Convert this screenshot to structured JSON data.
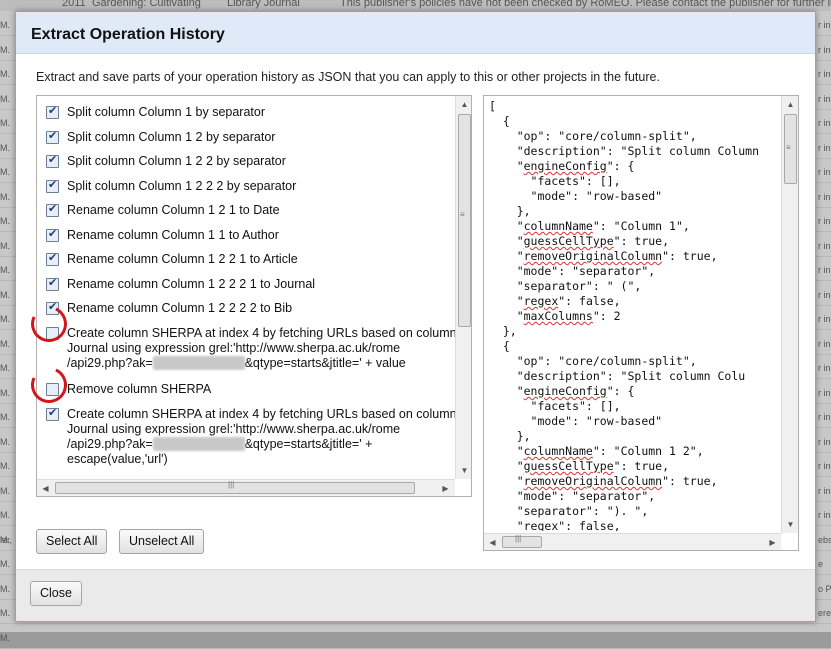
{
  "background": {
    "top_row": {
      "year": "2011",
      "title": "Gardening: Cultivating",
      "journal": "Library Journal",
      "notice": "This publisher's policies have not been checked by RoMEO. Please contact the publisher for further in"
    },
    "left_fragments": [
      "M.",
      "M.",
      "M.",
      "M.",
      "M.",
      "M.",
      "M.",
      "M.",
      "M.",
      "M.",
      "M.",
      "M.",
      "M.",
      "M.",
      "M.",
      "M.",
      "M.",
      "M.",
      "M.",
      "M.",
      "M.",
      "M.",
      "M.",
      "M.",
      "M.",
      "M.",
      "M.",
      "M.",
      "M.",
      "M.",
      "M."
    ],
    "right_fragments": [
      "r in",
      "r in",
      "r in",
      "r in",
      "r in",
      "r in",
      "r in",
      "r in",
      "r in",
      "r in",
      "r in",
      "r in",
      "r in",
      "r in",
      "r in",
      "r in",
      "r in",
      "r in",
      "r in",
      "r in",
      "r in",
      "ebs",
      "e",
      "o P",
      "ere"
    ],
    "left_extra": "ler,"
  },
  "dialog": {
    "title": "Extract Operation History",
    "intro": "Extract and save parts of your operation history as JSON that you can apply to this or other projects in the future."
  },
  "operations": [
    {
      "checked": true,
      "label": "Split column Column 1 by separator"
    },
    {
      "checked": true,
      "label": "Split column Column 1 2 by separator"
    },
    {
      "checked": true,
      "label": "Split column Column 1 2 2 by separator"
    },
    {
      "checked": true,
      "label": "Split column Column 1 2 2 2 by separator"
    },
    {
      "checked": true,
      "label": "Rename column Column 1 2 1 to Date"
    },
    {
      "checked": true,
      "label": "Rename column Column 1 1 to Author"
    },
    {
      "checked": true,
      "label": "Rename column Column 1 2 2 1 to Article"
    },
    {
      "checked": true,
      "label": "Rename column Column 1 2 2 2 1 to Journal"
    },
    {
      "checked": true,
      "label": "Rename column Column 1 2 2 2 2 to Bib"
    },
    {
      "checked": false,
      "label_a": "Create column SHERPA at index 4 by fetching URLs based on column Journal using expression grel:'http://www.sherpa.ac.uk/rome /api29.php?ak=",
      "label_b": "&qtype=starts&jtitle=' + value",
      "redacted": "XXXXXXXXXXX"
    },
    {
      "checked": false,
      "label": "Remove column SHERPA"
    },
    {
      "checked": true,
      "label_a": "Create column SHERPA at index 4 by fetching URLs based on column Journal using expression grel:'http://www.sherpa.ac.uk/rome /api29.php?ak=",
      "label_b": "&qtype=starts&jtitle=' + escape(value,'url')",
      "redacted": "XXXXXXXXXXX"
    }
  ],
  "json_lines": [
    "[",
    "  {",
    "    \"op\": \"core/column-split\",",
    "    \"description\": \"Split column Column",
    "    \"engineConfig\": {",
    "      \"facets\": [],",
    "      \"mode\": \"row-based\"",
    "    },",
    "    \"columnName\": \"Column 1\",",
    "    \"guessCellType\": true,",
    "    \"removeOriginalColumn\": true,",
    "    \"mode\": \"separator\",",
    "    \"separator\": \" (\",",
    "    \"regex\": false,",
    "    \"maxColumns\": 2",
    "  },",
    "  {",
    "    \"op\": \"core/column-split\",",
    "    \"description\": \"Split column Colu",
    "    \"engineConfig\": {",
    "      \"facets\": [],",
    "      \"mode\": \"row-based\"",
    "    },",
    "    \"columnName\": \"Column 1 2\",",
    "    \"guessCellType\": true,",
    "    \"removeOriginalColumn\": true,",
    "    \"mode\": \"separator\",",
    "    \"separator\": \"). \",",
    "    \"regex\": false,"
  ],
  "buttons": {
    "select_all": "Select All",
    "unselect_all": "Unselect All",
    "close": "Close"
  },
  "colors": {
    "header_bg": "#dfe9f7",
    "annotation_red": "#d2161c"
  }
}
